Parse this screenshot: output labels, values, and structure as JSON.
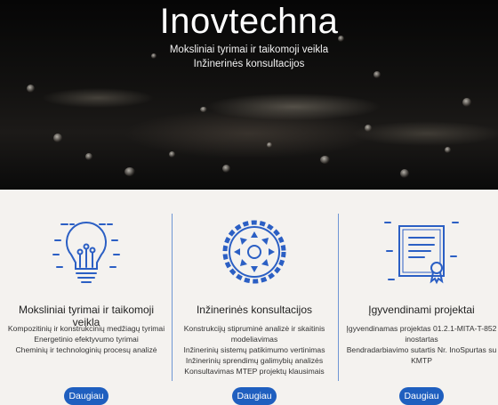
{
  "hero": {
    "title": "Inovtechna",
    "subtitle_1": "Moksliniai tyrimai ir taikomoji veikla",
    "subtitle_2": "Inžinerinės konsultacijos"
  },
  "accent_color": "#1f5fbf",
  "columns": [
    {
      "icon": "lightbulb-icon",
      "title": "Moksliniai tyrimai ir taikomoji veikla",
      "items": [
        "Kompozitinių ir konstrukcinių medžiagų tyrimai",
        "Energetinio efektyvumo tyrimai",
        "Cheminių ir technologinių procesų analizė"
      ],
      "button": "Daugiau"
    },
    {
      "icon": "gear-icon",
      "title": "Inžinerinės konsultacijos",
      "items": [
        "Konstrukcijų stipruminė analizė ir skaitinis",
        "modeliavimas",
        "Inžinerinių sistemų patikimumo vertinimas",
        "Inžinerinių sprendimų galimybių analizės",
        "Konsultavimas MTEP projektų klausimais"
      ],
      "button": "Daugiau"
    },
    {
      "icon": "certificate-icon",
      "title": "Įgyvendinami projektai",
      "items": [
        "Įgyvendinamas projektas 01.2.1-MITA-T-852",
        "inostartas",
        "Bendradarbiavimo sutartis Nr. InoSpurtas su",
        "KMTP"
      ],
      "button": "Daugiau"
    }
  ]
}
